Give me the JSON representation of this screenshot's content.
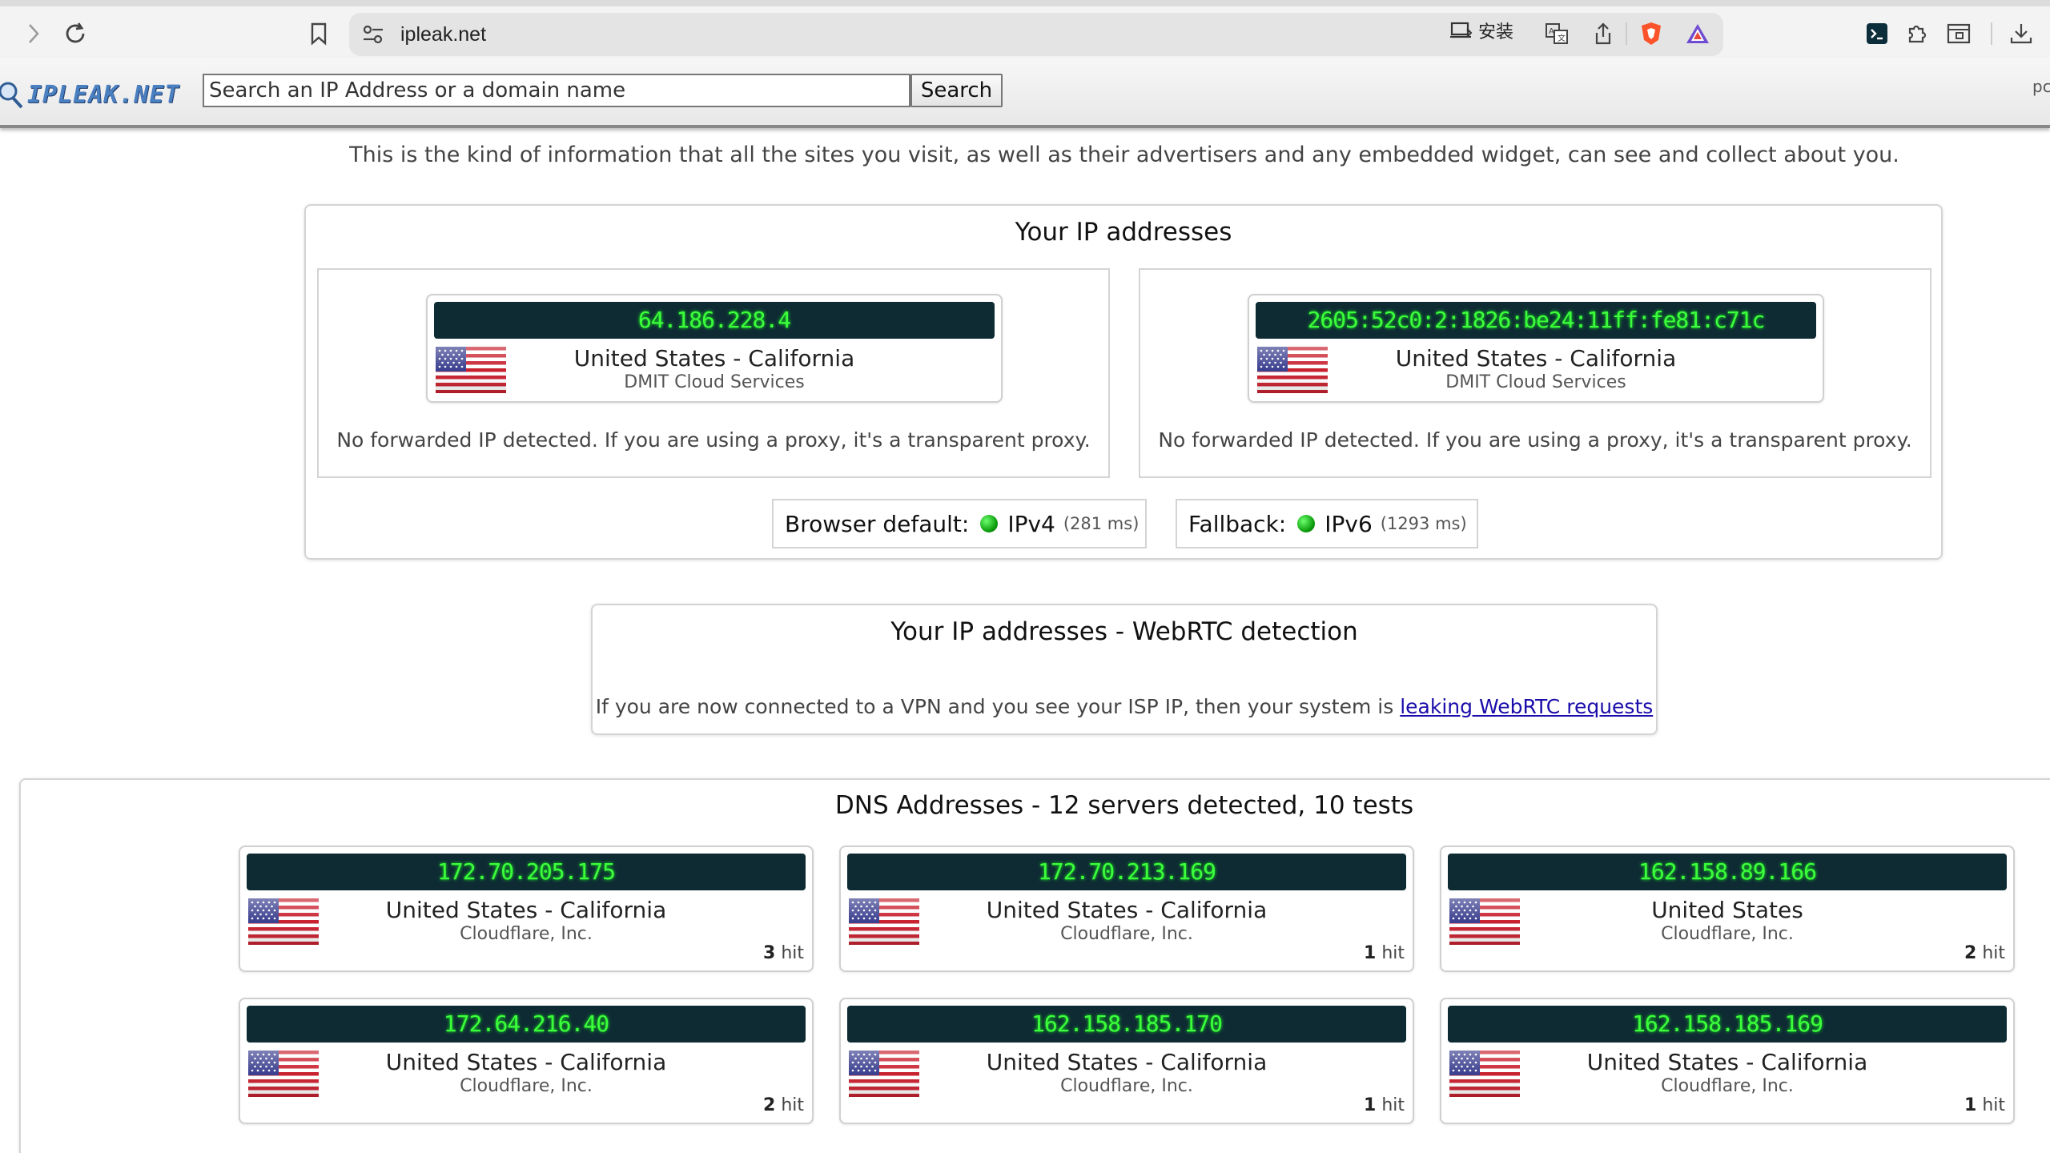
{
  "browser": {
    "url": "ipleak.net",
    "install_label": "安装"
  },
  "header": {
    "logo_text": "IPLEAK.NET",
    "search_placeholder": "Search an IP Address or a domain name",
    "search_button": "Search",
    "right_fragment": "pc"
  },
  "intro": "This is the kind of information that all the sites you visit, as well as their advertisers and any embedded widget, can see and collect about you.",
  "ip_section": {
    "title": "Your IP addresses",
    "cards": [
      {
        "ip": "64.186.228.4",
        "location": "United States - California",
        "isp": "DMIT Cloud Services",
        "note": "No forwarded IP detected. If you are using a proxy, it's a transparent proxy."
      },
      {
        "ip": "2605:52c0:2:1826:be24:11ff:fe81:c71c",
        "location": "United States - California",
        "isp": "DMIT Cloud Services",
        "note": "No forwarded IP detected. If you are using a proxy, it's a transparent proxy."
      }
    ],
    "browser_default": {
      "label": "Browser default:",
      "value": "IPv4",
      "ms": "(281 ms)"
    },
    "fallback": {
      "label": "Fallback:",
      "value": "IPv6",
      "ms": "(1293 ms)"
    }
  },
  "webrtc": {
    "title": "Your IP addresses - WebRTC detection",
    "note_prefix": "If you are now connected to a VPN and you see your ISP IP, then your system is",
    "note_link": "leaking WebRTC requests"
  },
  "dns": {
    "title": "DNS Addresses - 12 servers detected, 10 tests",
    "hit_word": "hit",
    "servers": [
      {
        "ip": "172.70.205.175",
        "location": "United States - California",
        "isp": "Cloudflare, Inc.",
        "hits": "3"
      },
      {
        "ip": "172.70.213.169",
        "location": "United States - California",
        "isp": "Cloudflare, Inc.",
        "hits": "1"
      },
      {
        "ip": "162.158.89.166",
        "location": "United States",
        "isp": "Cloudflare, Inc.",
        "hits": "2"
      },
      {
        "ip": "172.64.216.40",
        "location": "United States - California",
        "isp": "Cloudflare, Inc.",
        "hits": "2"
      },
      {
        "ip": "162.158.185.170",
        "location": "United States - California",
        "isp": "Cloudflare, Inc.",
        "hits": "1"
      },
      {
        "ip": "162.158.185.169",
        "location": "United States - California",
        "isp": "Cloudflare, Inc.",
        "hits": "1"
      }
    ]
  }
}
